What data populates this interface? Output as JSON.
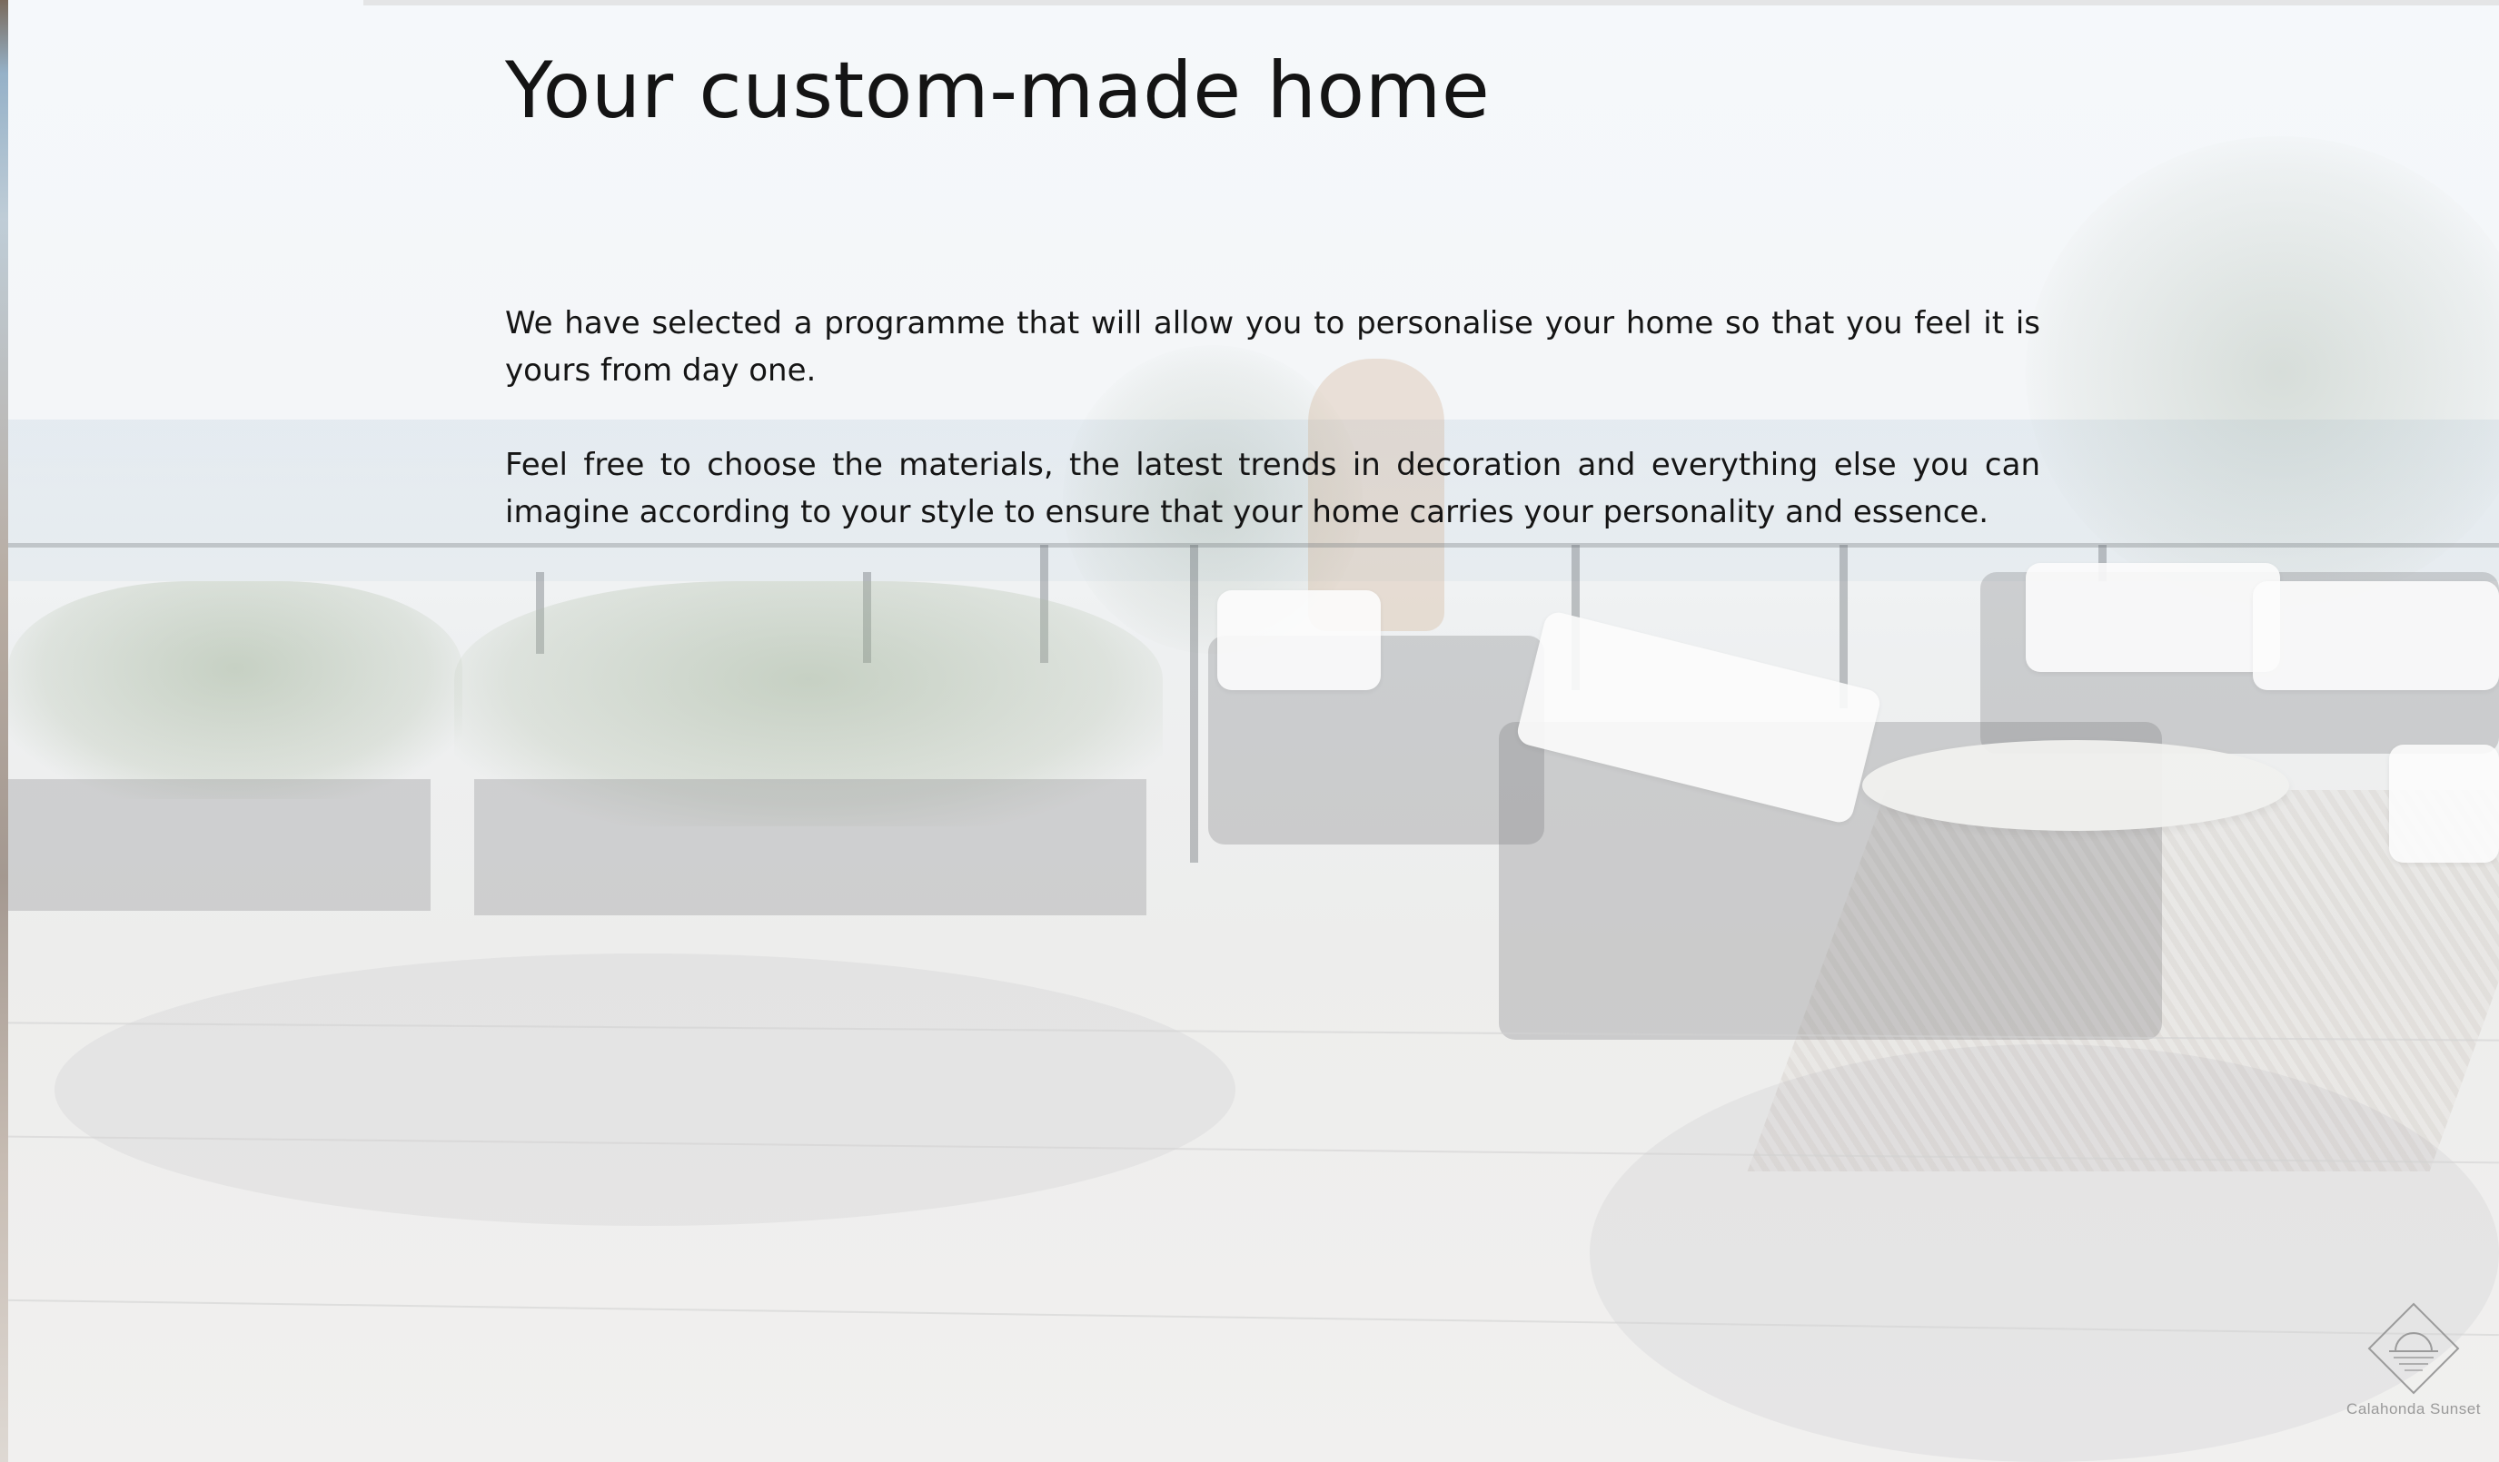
{
  "main": {
    "title": "Your custom-made home",
    "paragraphs": [
      "We have selected a programme that will allow you to personalise your home so that you feel it is yours from day one.",
      "Feel free to choose the materials, the latest trends in decoration and everything else you can imagine according to your style to ensure that your home carries your personality and essence."
    ]
  },
  "logo": {
    "name": "Calahonda Sunset",
    "icon": "diamond-sunset-icon"
  },
  "background": {
    "image": "terrace-with-sofas-and-plants-sea-view"
  }
}
